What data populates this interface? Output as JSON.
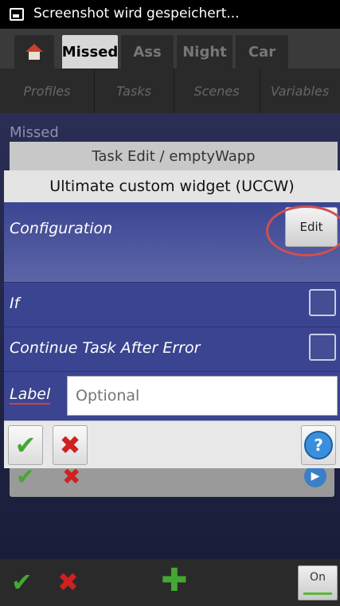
{
  "status_bar": {
    "text": "Screenshot wird gespeichert..."
  },
  "app_tabs": [
    "Missed",
    "Ass",
    "Night",
    "Car"
  ],
  "sub_tabs": [
    "Profiles",
    "Tasks",
    "Scenes",
    "Variables"
  ],
  "background": {
    "missed_label": "Missed",
    "task_edit_title": "Task Edit / emptyWapp"
  },
  "dialog": {
    "title": "Ultimate custom widget (UCCW)",
    "configuration_label": "Configuration",
    "edit_label": "Edit",
    "if_label": "If",
    "continue_label": "Continue Task After Error",
    "label_label": "Label",
    "label_placeholder": "Optional",
    "help_glyph": "?"
  },
  "bottom_bar": {
    "on_label": "On"
  },
  "icons": [
    "screenshot-icon",
    "home-icon",
    "check-icon",
    "cross-icon",
    "help-icon",
    "plus-icon",
    "play-icon"
  ]
}
